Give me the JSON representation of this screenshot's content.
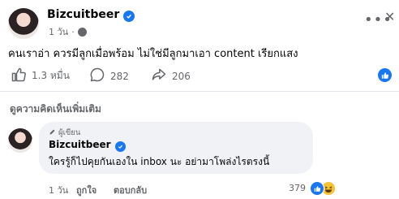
{
  "post": {
    "author": "Bizcuitbeer",
    "time": "1 วัน",
    "more_label": "•••",
    "close_label": "✕",
    "text": "คนเราอ่า ควรมีลูกเมื่อพร้อม ไม่ใช่มีลูกมาเอา content เรียกแสง"
  },
  "actions": {
    "likes": "1.3 หมื่น",
    "comments": "282",
    "shares": "206"
  },
  "comments_section": {
    "more_comments_label": "ดูความคิดเห็นเพิ่มเติม"
  },
  "comment": {
    "badge": "ผู้เขียน",
    "author": "Bizcuitbeer",
    "text": "ใครรู้ก็ไปคุยกันเองใน inbox นะ อย่ามาโพล่งไรตรงนี้",
    "time": "1 วัน",
    "like_label": "ถูกใจ",
    "reply_label": "ตอบกลับ",
    "reaction_count": "379"
  },
  "colors": {
    "accent": "#1877f2",
    "secondary_text": "#65676b",
    "bubble": "#f0f2f5"
  }
}
